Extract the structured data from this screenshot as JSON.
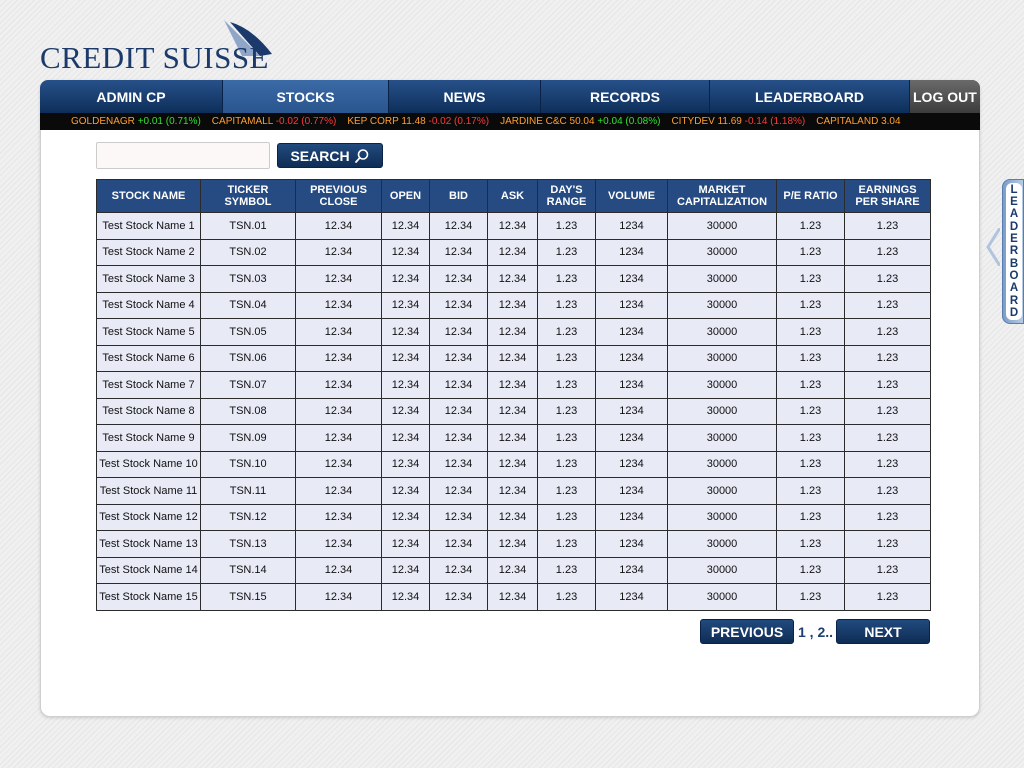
{
  "brand": {
    "name": "Credit Suisse",
    "logo_text": "CREDIT SUISSE",
    "logo_icon": "sails-logo-icon"
  },
  "nav": {
    "items": [
      {
        "label": "ADMIN CP",
        "active": false
      },
      {
        "label": "STOCKS",
        "active": true
      },
      {
        "label": "NEWS",
        "active": false
      },
      {
        "label": "RECORDS",
        "active": false
      },
      {
        "label": "LEADERBOARD",
        "active": false
      }
    ],
    "logout_label": "LOG OUT"
  },
  "ticker": [
    {
      "name": "GOLDENAGR",
      "change": "+0.01 (0.71%)",
      "dir": "up"
    },
    {
      "name": "CAPITAMALL",
      "change": "-0.02 (0.77%)",
      "dir": "down"
    },
    {
      "name": "KEP CORP 11.48",
      "change": "-0.02 (0.17%)",
      "dir": "down"
    },
    {
      "name": "JARDINE C&C 50.04",
      "change": "+0.04 (0.08%)",
      "dir": "up"
    },
    {
      "name": "CITYDEV 11.69",
      "change": "-0.14 (1.18%)",
      "dir": "down"
    },
    {
      "name": "CAPITALAND 3.04",
      "change": "",
      "dir": ""
    }
  ],
  "search": {
    "value": "",
    "placeholder": "",
    "button_label": "SEARCH",
    "icon": "magnifier-icon"
  },
  "table": {
    "headers": [
      "STOCK NAME",
      "TICKER\nSYMBOL",
      "PREVIOUS\nCLOSE",
      "OPEN",
      "BID",
      "ASK",
      "DAY'S\nRANGE",
      "VOLUME",
      "MARKET\nCAPITALIZATION",
      "P/E RATIO",
      "EARNINGS\nPER SHARE"
    ],
    "rows": [
      [
        "Test Stock Name 1",
        "TSN.01",
        "12.34",
        "12.34",
        "12.34",
        "12.34",
        "1.23",
        "1234",
        "30000",
        "1.23",
        "1.23"
      ],
      [
        "Test Stock Name 2",
        "TSN.02",
        "12.34",
        "12.34",
        "12.34",
        "12.34",
        "1.23",
        "1234",
        "30000",
        "1.23",
        "1.23"
      ],
      [
        "Test Stock Name 3",
        "TSN.03",
        "12.34",
        "12.34",
        "12.34",
        "12.34",
        "1.23",
        "1234",
        "30000",
        "1.23",
        "1.23"
      ],
      [
        "Test Stock Name 4",
        "TSN.04",
        "12.34",
        "12.34",
        "12.34",
        "12.34",
        "1.23",
        "1234",
        "30000",
        "1.23",
        "1.23"
      ],
      [
        "Test Stock Name 5",
        "TSN.05",
        "12.34",
        "12.34",
        "12.34",
        "12.34",
        "1.23",
        "1234",
        "30000",
        "1.23",
        "1.23"
      ],
      [
        "Test Stock Name 6",
        "TSN.06",
        "12.34",
        "12.34",
        "12.34",
        "12.34",
        "1.23",
        "1234",
        "30000",
        "1.23",
        "1.23"
      ],
      [
        "Test Stock Name 7",
        "TSN.07",
        "12.34",
        "12.34",
        "12.34",
        "12.34",
        "1.23",
        "1234",
        "30000",
        "1.23",
        "1.23"
      ],
      [
        "Test Stock Name 8",
        "TSN.08",
        "12.34",
        "12.34",
        "12.34",
        "12.34",
        "1.23",
        "1234",
        "30000",
        "1.23",
        "1.23"
      ],
      [
        "Test Stock Name 9",
        "TSN.09",
        "12.34",
        "12.34",
        "12.34",
        "12.34",
        "1.23",
        "1234",
        "30000",
        "1.23",
        "1.23"
      ],
      [
        "Test Stock Name 10",
        "TSN.10",
        "12.34",
        "12.34",
        "12.34",
        "12.34",
        "1.23",
        "1234",
        "30000",
        "1.23",
        "1.23"
      ],
      [
        "Test Stock Name 11",
        "TSN.11",
        "12.34",
        "12.34",
        "12.34",
        "12.34",
        "1.23",
        "1234",
        "30000",
        "1.23",
        "1.23"
      ],
      [
        "Test Stock Name 12",
        "TSN.12",
        "12.34",
        "12.34",
        "12.34",
        "12.34",
        "1.23",
        "1234",
        "30000",
        "1.23",
        "1.23"
      ],
      [
        "Test Stock Name 13",
        "TSN.13",
        "12.34",
        "12.34",
        "12.34",
        "12.34",
        "1.23",
        "1234",
        "30000",
        "1.23",
        "1.23"
      ],
      [
        "Test Stock Name 14",
        "TSN.14",
        "12.34",
        "12.34",
        "12.34",
        "12.34",
        "1.23",
        "1234",
        "30000",
        "1.23",
        "1.23"
      ],
      [
        "Test Stock Name 15",
        "TSN.15",
        "12.34",
        "12.34",
        "12.34",
        "12.34",
        "1.23",
        "1234",
        "30000",
        "1.23",
        "1.23"
      ]
    ]
  },
  "pagination": {
    "previous_label": "PREVIOUS",
    "pages_text": "1 , 2..",
    "next_label": "NEXT"
  },
  "side_tab": {
    "label": "LEADERBOARD"
  },
  "colors": {
    "brand_navy": "#1b3a6b",
    "nav_blue": "#0d2e59",
    "header_blue": "#254b82",
    "cell_bg": "#e8eaf6",
    "ticker_up": "#33e033",
    "ticker_down": "#ff3a3a",
    "ticker_name": "#ff9e30"
  }
}
